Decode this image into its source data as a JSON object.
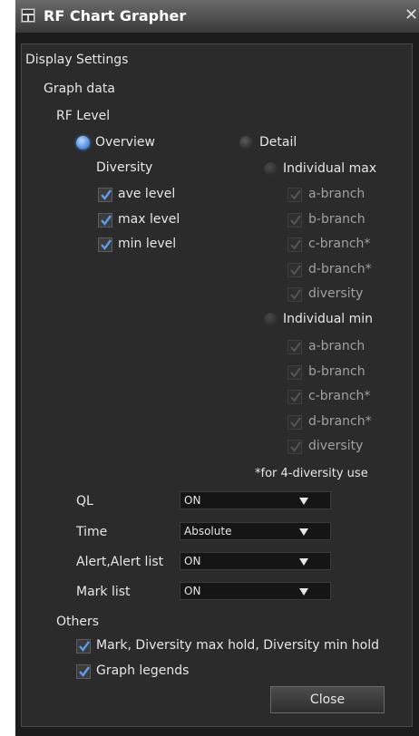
{
  "window": {
    "title": "RF Chart Grapher"
  },
  "labels": {
    "display_settings": "Display Settings",
    "graph_data": "Graph data",
    "rf_level": "RF Level"
  },
  "overview": {
    "label": "Overview",
    "selected": true,
    "diversity_label": "Diversity",
    "items": [
      {
        "label": "ave level",
        "checked": true
      },
      {
        "label": "max level",
        "checked": true
      },
      {
        "label": "min level",
        "checked": true
      }
    ]
  },
  "detail": {
    "label": "Detail",
    "selected": false,
    "individual_max": {
      "label": "Individual max",
      "items": [
        {
          "label": "a-branch"
        },
        {
          "label": "b-branch"
        },
        {
          "label": "c-branch*"
        },
        {
          "label": "d-branch*"
        },
        {
          "label": "diversity"
        }
      ]
    },
    "individual_min": {
      "label": "Individual min",
      "items": [
        {
          "label": "a-branch"
        },
        {
          "label": "b-branch"
        },
        {
          "label": "c-branch*"
        },
        {
          "label": "d-branch*"
        },
        {
          "label": "diversity"
        }
      ]
    },
    "note": "*for 4-diversity use"
  },
  "settings": [
    {
      "label": "QL",
      "value": "ON"
    },
    {
      "label": "Time",
      "value": "Absolute"
    },
    {
      "label": "Alert,Alert list",
      "value": "ON"
    },
    {
      "label": "Mark list",
      "value": "ON"
    }
  ],
  "others": {
    "label": "Others",
    "items": [
      {
        "label": "Mark, Diversity max hold, Diversity min hold",
        "checked": true
      },
      {
        "label": "Graph legends",
        "checked": true
      }
    ]
  },
  "buttons": {
    "close": "Close"
  },
  "colors": {
    "window_bg": "#1c1c1c",
    "panel_bg": "#2b2b2b",
    "accent": "#4f8be0"
  }
}
